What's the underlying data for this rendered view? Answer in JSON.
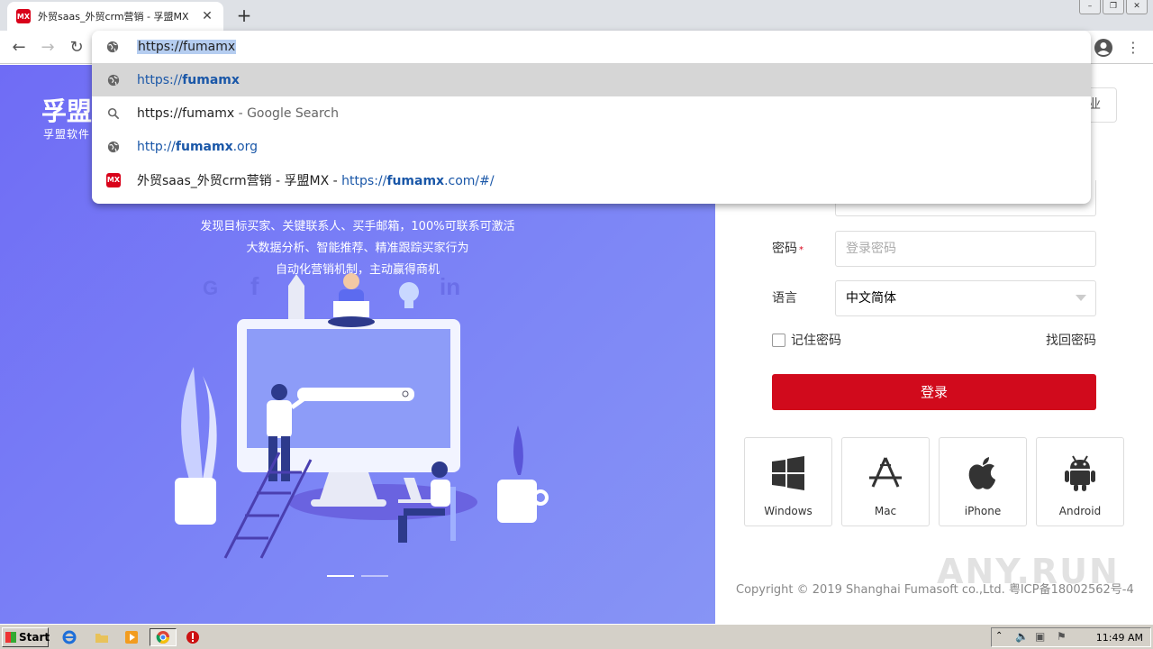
{
  "browser": {
    "tab_title": "外贸saas_外贸crm营销 - 孚盟MX",
    "favicon_text": "MX",
    "address_text": "https://fumamx"
  },
  "omnibox": {
    "suggestions": [
      {
        "type": "url",
        "prefix": "https://",
        "bold": "fumamx",
        "suffix": "",
        "icon": "globe-icon"
      },
      {
        "type": "search",
        "text": "https://fumamx",
        "hint": " - Google Search",
        "icon": "search-icon"
      },
      {
        "type": "url",
        "prefix": "http://",
        "bold": "fumamx",
        "suffix": ".org",
        "icon": "globe-icon"
      },
      {
        "type": "history",
        "title": "外贸saas_外贸crm营销 - 孚盟MX",
        "sep": " - ",
        "prefix": "https://",
        "bold": "fumamx",
        "suffix": ".com/#/",
        "icon": "mx-favicon"
      }
    ]
  },
  "hero": {
    "brand": "孚盟",
    "brand_sub": "孚盟软件",
    "lines": [
      "发现目标买家、关键联系人、买手邮箱，100%可联系可激活",
      "大数据分析、智能推荐、精准跟踪买家行为",
      "自动化营销机制，主动赢得商机"
    ]
  },
  "login": {
    "top_button_fragment": "业",
    "password_label": "密码",
    "required_mark": "*",
    "password_placeholder": "登录密码",
    "language_label": "语言",
    "language_value": "中文简体",
    "remember_label": "记住密码",
    "forgot_label": "找回密码",
    "login_button": "登录"
  },
  "apps": [
    {
      "label": "Windows",
      "icon": "windows-icon"
    },
    {
      "label": "Mac",
      "icon": "app-store-icon"
    },
    {
      "label": "iPhone",
      "icon": "apple-icon"
    },
    {
      "label": "Android",
      "icon": "android-icon"
    }
  ],
  "footer": {
    "copyright": "Copyright © 2019 Shanghai Fumasoft co.,Ltd. 粤ICP备18002562号-4"
  },
  "watermark": "ANY.RUN",
  "taskbar": {
    "start_label": "Start",
    "clock": "11:49 AM"
  },
  "colors": {
    "accent_red": "#d10a1c",
    "hero_purple": "#7478f5",
    "omnibox_link": "#1a57a8"
  }
}
